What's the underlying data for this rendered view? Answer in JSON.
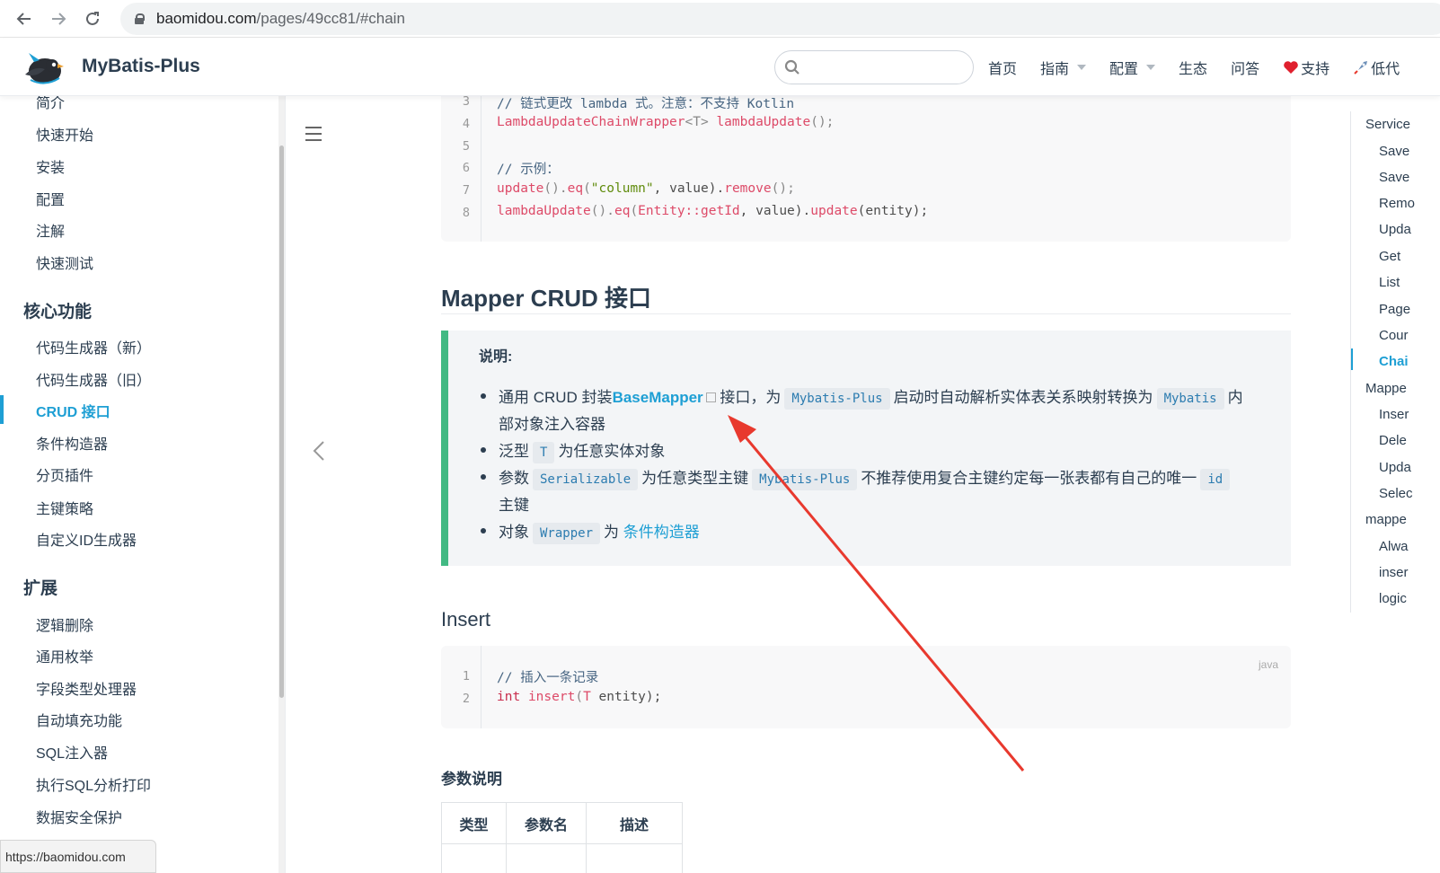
{
  "browser": {
    "url_domain": "baomidou.com",
    "url_rest": "/pages/49cc81/#chain"
  },
  "header": {
    "title": "MyBatis-Plus",
    "search_placeholder": "",
    "nav": [
      "首页",
      "指南",
      "配置",
      "生态",
      "问答",
      "支持",
      "低代"
    ]
  },
  "sidebar": {
    "items_top": [
      "简介",
      "快速开始",
      "安装",
      "配置",
      "注解",
      "快速测试"
    ],
    "group_core": "核心功能",
    "items_core": [
      "代码生成器（新）",
      "代码生成器（旧）",
      "CRUD 接口",
      "条件构造器",
      "分页插件",
      "主键策略",
      "自定义ID生成器"
    ],
    "group_ext": "扩展",
    "items_ext": [
      "逻辑删除",
      "通用枚举",
      "字段类型处理器",
      "自动填充功能",
      "SQL注入器",
      "执行SQL分析打印",
      "数据安全保护"
    ],
    "status_url": "https://baomidou.com"
  },
  "code_top": {
    "line_numbers": [
      "3",
      "4",
      "5",
      "6",
      "7",
      "8"
    ],
    "line3": "// 链式更改 lambda 式。注意：不支持 Kotlin",
    "line4_type": "LambdaUpdateChainWrapper",
    "line4_gen": "<T>",
    "line4_fn": "lambdaUpdate",
    "line4_end": "();",
    "line6": "// 示例：",
    "line7_a": "update",
    "line7_b": "().",
    "line7_c": "eq",
    "line7_d": "(",
    "line7_str": "\"column\"",
    "line7_e": ", value).",
    "line7_f": "remove",
    "line7_g": "();",
    "line8_a": "lambdaUpdate",
    "line8_b": "().",
    "line8_c": "eq",
    "line8_d": "(",
    "line8_e": "Entity::getId",
    "line8_f": ", value).",
    "line8_g": "update",
    "line8_h": "(entity);"
  },
  "section": {
    "title": "Mapper CRUD 接口",
    "tip_title": "说明:",
    "b1_a": "通用 CRUD 封装",
    "b1_link": "BaseMapper",
    "b1_b": "接口，为",
    "b1_code1": "Mybatis-Plus",
    "b1_c": "启动时自动解析实体表关系映射转换为",
    "b1_code2": "Mybatis",
    "b1_d": "内",
    "b1_e": "部对象注入容器",
    "b2_a": "泛型",
    "b2_code": "T",
    "b2_b": "为任意实体对象",
    "b3_a": "参数",
    "b3_code1": "Serializable",
    "b3_b": "为任意类型主键",
    "b3_code2": "Mybatis-Plus",
    "b3_c": "不推荐使用复合主键约定每一张表都有自己的唯一",
    "b3_code3": "id",
    "b3_d": "主键",
    "b4_a": "对象",
    "b4_code": "Wrapper",
    "b4_b": "为",
    "b4_link": "条件构造器"
  },
  "insert": {
    "title": "Insert",
    "lang": "java",
    "line_numbers": [
      "1",
      "2"
    ],
    "line1": "// 插入一条记录",
    "line2_kw": "int",
    "line2_fn": "insert",
    "line2_a": "(",
    "line2_t": "T",
    "line2_b": " entity);"
  },
  "params": {
    "title": "参数说明",
    "headers": [
      "类型",
      "参数名",
      "描述"
    ]
  },
  "toc": {
    "items": [
      "Service",
      "Save",
      "Save",
      "Remo",
      "Upda",
      "Get",
      "List",
      "Page",
      "Cour",
      "Chai",
      "Mappe",
      "Inser",
      "Dele",
      "Upda",
      "Selec",
      "mappe",
      "Alwa",
      "inser",
      "logic"
    ],
    "active_index": 9
  },
  "colors": {
    "accent": "#1e9fd4",
    "tip_border": "#42b983",
    "arrow": "#e8392e"
  }
}
